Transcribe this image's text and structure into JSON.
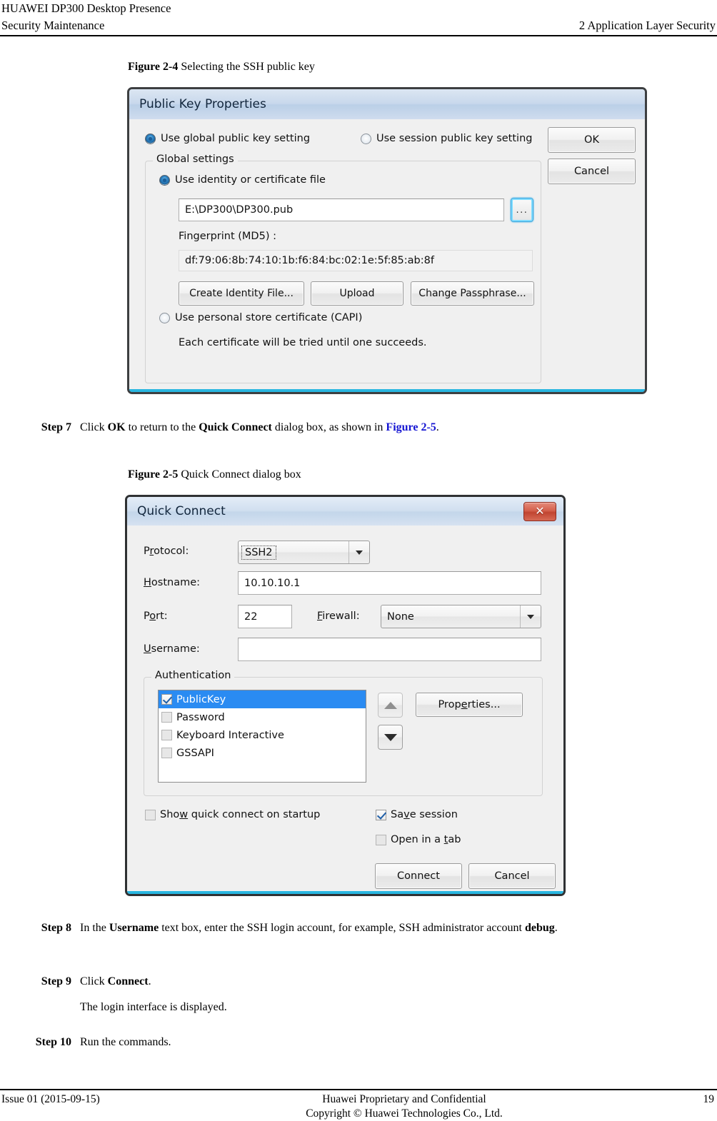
{
  "header": {
    "product": "HUAWEI DP300 Desktop Presence",
    "doc_title": "Security Maintenance",
    "chapter": "2 Application Layer Security"
  },
  "figure_2_4": {
    "label": "Figure 2-4",
    "caption": "Selecting the SSH public key"
  },
  "public_key_properties": {
    "title": "Public Key Properties",
    "radio_global": "Use global public key setting",
    "radio_session": "Use session public key setting",
    "ok_label": "OK",
    "cancel_label": "Cancel",
    "group_label": "Global settings",
    "radio_identity": "Use identity or certificate file",
    "identity_path": "E:\\DP300\\DP300.pub",
    "browse_label": "...",
    "fingerprint_label": "Fingerprint (MD5) :",
    "fingerprint_value": "df:79:06:8b:74:10:1b:f6:84:bc:02:1e:5f:85:ab:8f",
    "btn_create_identity": "Create Identity File...",
    "btn_upload": "Upload",
    "btn_change_passphrase": "Change Passphrase...",
    "radio_capi": "Use personal store certificate (CAPI)",
    "capi_note": "Each certificate will be tried until one succeeds."
  },
  "step7": {
    "num": "Step 7",
    "t1": "Click ",
    "b1": "OK",
    "t2": " to return to the ",
    "b2": "Quick Connect",
    "t3": " dialog box, as shown in ",
    "xref": "Figure 2-5",
    "t4": "."
  },
  "figure_2_5": {
    "label": "Figure 2-5",
    "caption": "Quick Connect dialog box"
  },
  "quick_connect": {
    "title": "Quick Connect",
    "close_glyph": "✕",
    "protocol_label_pre": "P",
    "protocol_label_acc": "r",
    "protocol_label_post": "otocol:",
    "protocol_value": "SSH2",
    "hostname_label_acc": "H",
    "hostname_label_post": "ostname:",
    "hostname_value": "10.10.10.1",
    "port_label_pre": "P",
    "port_label_acc": "o",
    "port_label_post": "rt:",
    "port_value": "22",
    "firewall_label_acc": "F",
    "firewall_label_post": "irewall:",
    "firewall_value": "None",
    "username_label_acc": "U",
    "username_label_post": "sername:",
    "username_value": "",
    "auth_group_label": "Authentication",
    "auth_items": [
      {
        "label": "PublicKey",
        "checked": true,
        "selected": true
      },
      {
        "label": "Password",
        "checked": false,
        "selected": false
      },
      {
        "label": "Keyboard Interactive",
        "checked": false,
        "selected": false
      },
      {
        "label": "GSSAPI",
        "checked": false,
        "selected": false
      }
    ],
    "properties_label_pre": "Prop",
    "properties_label_acc": "e",
    "properties_label_post": "rties...",
    "show_startup_pre": "Sho",
    "show_startup_acc": "w",
    "show_startup_post": " quick connect on startup",
    "show_startup_checked": false,
    "save_session_pre": "Sa",
    "save_session_acc": "v",
    "save_session_post": "e session",
    "save_session_checked": true,
    "open_tab_pre": "Open in a ",
    "open_tab_acc": "t",
    "open_tab_post": "ab",
    "open_tab_checked": false,
    "connect_label": "Connect",
    "cancel_label": "Cancel"
  },
  "step8": {
    "num": "Step 8",
    "t1": "In the ",
    "b1": "Username",
    "t2": " text box, enter the SSH login account, for example, SSH administrator account ",
    "b2": "debug",
    "t3": "."
  },
  "step9": {
    "num": "Step 9",
    "t1": "Click ",
    "b1": "Connect",
    "t2": ".",
    "sub": "The login interface is displayed."
  },
  "step10": {
    "num": "Step 10",
    "t1": "Run the commands."
  },
  "footer": {
    "issue": "Issue 01 (2015-09-15)",
    "line1": "Huawei Proprietary and Confidential",
    "line2": "Copyright © Huawei Technologies Co., Ltd.",
    "page": "19"
  }
}
